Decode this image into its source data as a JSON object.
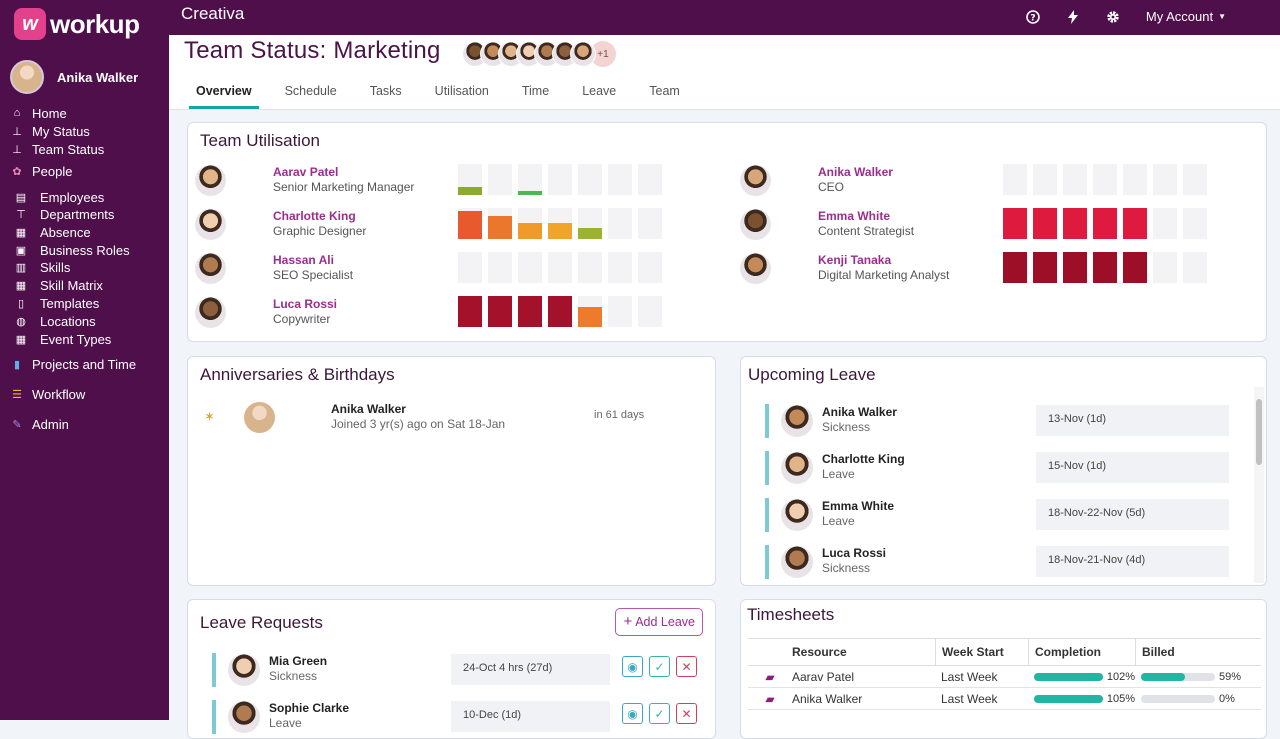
{
  "app": {
    "logo": "workup",
    "org": "Creativa",
    "account": "My Account"
  },
  "user": {
    "name": "Anika Walker"
  },
  "nav": [
    {
      "label": "Home",
      "icon": "home-icon"
    },
    {
      "label": "My Status",
      "icon": "org-chart-icon"
    },
    {
      "label": "Team Status",
      "icon": "org-chart-icon"
    },
    {
      "label": "People",
      "icon": "paw-icon"
    },
    {
      "label": "Employees",
      "icon": "id-card-icon"
    },
    {
      "label": "Departments",
      "icon": "sitemap-icon"
    },
    {
      "label": "Absence",
      "icon": "calendar-icon"
    },
    {
      "label": "Business Roles",
      "icon": "briefcase-icon"
    },
    {
      "label": "Skills",
      "icon": "sofa-icon"
    },
    {
      "label": "Skill Matrix",
      "icon": "grid-icon"
    },
    {
      "label": "Templates",
      "icon": "document-icon"
    },
    {
      "label": "Locations",
      "icon": "globe-icon"
    },
    {
      "label": "Event Types",
      "icon": "calendar-event-icon"
    },
    {
      "label": "Projects and Time",
      "icon": "bar-chart-icon"
    },
    {
      "label": "Workflow",
      "icon": "list-icon"
    },
    {
      "label": "Admin",
      "icon": "wrench-icon"
    }
  ],
  "page": {
    "title": "Team Status: Marketing",
    "more_count": "+1"
  },
  "tabs": [
    "Overview",
    "Schedule",
    "Tasks",
    "Utilisation",
    "Time",
    "Leave",
    "Team"
  ],
  "utilisation": {
    "title": "Team Utilisation",
    "people": [
      {
        "name": "Aarav Patel",
        "role": "Senior Marketing Manager",
        "levels": [
          0.25,
          0,
          0.12,
          0,
          0,
          0,
          0
        ],
        "colors": [
          "#8bab2e",
          "",
          "#4cb84e",
          "",
          "",
          "",
          ""
        ]
      },
      {
        "name": "Charlotte King",
        "role": "Graphic Designer",
        "levels": [
          0.9,
          0.75,
          0.5,
          0.5,
          0.35,
          0,
          0
        ],
        "colors": [
          "#e85a2d",
          "#eb772d",
          "#f09a2a",
          "#f0a52a",
          "#9bb32e",
          "",
          ""
        ]
      },
      {
        "name": "Hassan Ali",
        "role": "SEO Specialist",
        "levels": [
          0,
          0,
          0,
          0,
          0,
          0,
          0
        ],
        "colors": [
          "",
          "",
          "",
          "",
          "",
          "",
          ""
        ]
      },
      {
        "name": "Luca Rossi",
        "role": "Copywriter",
        "levels": [
          1,
          1,
          1,
          1,
          0.65,
          0,
          0
        ],
        "colors": [
          "#a3122a",
          "#a3122a",
          "#a3122a",
          "#a3122a",
          "#ee7a2c",
          "",
          ""
        ]
      },
      {
        "name": "Anika Walker",
        "role": "CEO",
        "levels": [
          0,
          0,
          0,
          0,
          0,
          0,
          0
        ],
        "colors": [
          "",
          "",
          "",
          "",
          "",
          "",
          ""
        ]
      },
      {
        "name": "Emma White",
        "role": "Content Strategist",
        "levels": [
          1,
          1,
          1,
          1,
          1,
          0,
          0
        ],
        "colors": [
          "#de1b3e",
          "#de1b3e",
          "#de1b3e",
          "#de1b3e",
          "#de1b3e",
          "",
          ""
        ]
      },
      {
        "name": "Kenji Tanaka",
        "role": "Digital Marketing Analyst",
        "levels": [
          1,
          1,
          1,
          1,
          1,
          0,
          0
        ],
        "colors": [
          "#9c0f27",
          "#9c0f27",
          "#9c0f27",
          "#9c0f27",
          "#9c0f27",
          "",
          ""
        ]
      }
    ]
  },
  "anniversaries": {
    "title": "Anniversaries & Birthdays",
    "items": [
      {
        "name": "Anika Walker",
        "detail": "Joined 3 yr(s) ago on Sat 18-Jan",
        "when": "in 61 days"
      }
    ]
  },
  "upcoming_leave": {
    "title": "Upcoming Leave",
    "items": [
      {
        "name": "Anika Walker",
        "type": "Sickness",
        "date": "13-Nov (1d)"
      },
      {
        "name": "Charlotte King",
        "type": "Leave",
        "date": "15-Nov (1d)"
      },
      {
        "name": "Emma White",
        "type": "Leave",
        "date": "18-Nov-22-Nov (5d)"
      },
      {
        "name": "Luca Rossi",
        "type": "Sickness",
        "date": "18-Nov-21-Nov (4d)"
      }
    ]
  },
  "leave_requests": {
    "title": "Leave Requests",
    "add_label": "Add Leave",
    "items": [
      {
        "name": "Mia Green",
        "type": "Sickness",
        "date": "24-Oct 4 hrs (27d)"
      },
      {
        "name": "Sophie Clarke",
        "type": "Leave",
        "date": "10-Dec (1d)"
      }
    ]
  },
  "timesheets": {
    "title": "Timesheets",
    "headers": [
      "Resource",
      "Week Start",
      "Completion",
      "Billed"
    ],
    "rows": [
      {
        "resource": "Aarav Patel",
        "week": "Last Week",
        "completion": 1.02,
        "completion_label": "102%",
        "billed": 0.59,
        "billed_label": "59%"
      },
      {
        "resource": "Anika Walker",
        "week": "Last Week",
        "completion": 1.05,
        "completion_label": "105%",
        "billed": 0,
        "billed_label": "0%"
      }
    ]
  }
}
